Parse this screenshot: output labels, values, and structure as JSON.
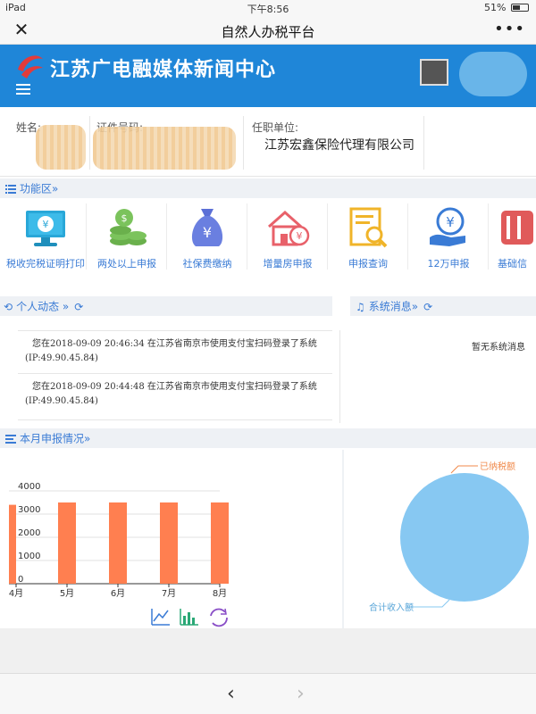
{
  "status": {
    "left": "iPad",
    "time": "下午8:56",
    "battery": "51%",
    "battery_level": 0.51
  },
  "navbar": {
    "title": "自然人办税平台",
    "close_icon": "close-icon",
    "more_icon": "more-icon"
  },
  "banner": {
    "org_name": "江苏广电融媒体新闻中心"
  },
  "info": {
    "name_label": "姓名:",
    "id_label": "证件号码:",
    "employer_label": "任职单位:",
    "employer_value": "江苏宏鑫保险代理有限公司"
  },
  "sections": {
    "functions": "功能区»",
    "activity": "个人动态 »",
    "system": "系统消息»",
    "monthly": "本月申报情况»"
  },
  "functions": [
    {
      "label": "税收完税证明打印",
      "icon": "monitor-icon"
    },
    {
      "label": "两处以上申报",
      "icon": "coins-icon"
    },
    {
      "label": "社保费缴纳",
      "icon": "money-bag-icon"
    },
    {
      "label": "增量房申报",
      "icon": "house-icon"
    },
    {
      "label": "申报查询",
      "icon": "document-search-icon"
    },
    {
      "label": "12万申报",
      "icon": "yen-hand-icon"
    },
    {
      "label": "基础信",
      "icon": "book-icon"
    }
  ],
  "activity": [
    {
      "line1": "您在2018-09-09 20:46:34 在江苏省南京市使用支付宝扫码登录了系统",
      "line2": "(IP:49.90.45.84)"
    },
    {
      "line1": "您在2018-09-09 20:44:48 在江苏省南京市使用支付宝扫码登录了系统",
      "line2": "(IP:49.90.45.84)"
    }
  ],
  "system_message": "暂无系统消息",
  "colors": {
    "banner": "#1f86d8",
    "bar": "#ff7f50",
    "pie": "#87c8f2",
    "link": "#3a7bd5"
  },
  "chart_data": [
    {
      "type": "bar",
      "categories": [
        "4月",
        "5月",
        "6月",
        "7月",
        "8月"
      ],
      "values": [
        3400,
        3500,
        3500,
        3500,
        3500
      ],
      "ylim": [
        0,
        4000
      ],
      "yticks": [
        "0",
        "1000",
        "2000",
        "3000",
        "4000"
      ],
      "grid": true,
      "toolbox_icons": [
        "line-chart-icon",
        "bar-chart-icon",
        "refresh-icon"
      ]
    },
    {
      "type": "pie",
      "labels": [
        "已纳税额",
        "合计收入额"
      ],
      "values": [
        0,
        1
      ]
    }
  ]
}
